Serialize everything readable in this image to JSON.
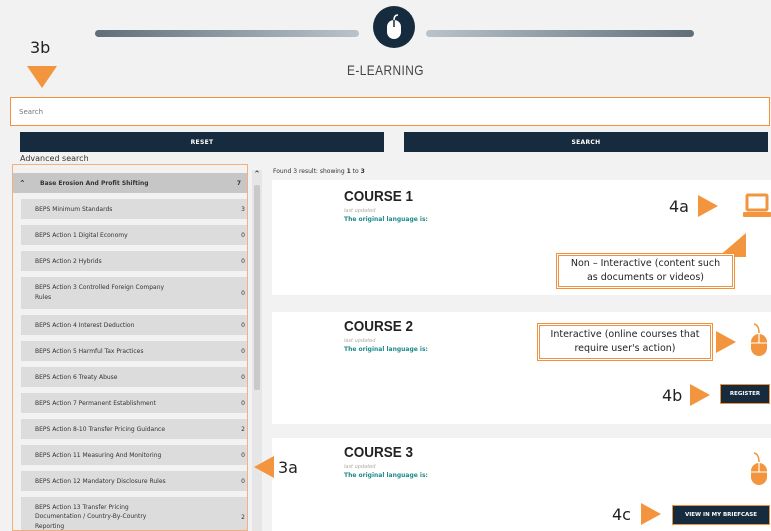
{
  "header": {
    "title": "E-LEARNING"
  },
  "search": {
    "placeholder": "Search"
  },
  "buttons": {
    "reset": "RESET",
    "search": "SEARCH",
    "register": "REGISTER",
    "briefcase": "VIEW IN MY BRIEFCASE"
  },
  "advanced_search": "Advanced search",
  "sidebar": {
    "top": {
      "label": "Base Erosion And Profit Shifting",
      "count": "7"
    },
    "items": [
      {
        "label": "BEPS Minimum Standards",
        "count": "3"
      },
      {
        "label": "BEPS Action 1 Digital Economy",
        "count": "0"
      },
      {
        "label": "BEPS Action 2 Hybrids",
        "count": "0"
      },
      {
        "label": "BEPS Action 3 Controlled Foreign Company",
        "label2": "Rules",
        "count": "0"
      },
      {
        "label": "BEPS Action 4 Interest Deduction",
        "count": "0"
      },
      {
        "label": "BEPS Action 5 Harmful Tax Practices",
        "count": "0"
      },
      {
        "label": "BEPS Action 6 Treaty Abuse",
        "count": "0"
      },
      {
        "label": "BEPS Action 7 Permanent Establishment",
        "count": "0"
      },
      {
        "label": "BEPS Action 8-10 Transfer Pricing Guidance",
        "count": "2"
      },
      {
        "label": "BEPS Action 11 Measuring And Monitoring",
        "count": "0"
      },
      {
        "label": "BEPS Action 12 Mandatory Disclosure Rules",
        "count": "0"
      },
      {
        "label": "BEPS Action 13 Transfer Pricing",
        "label2": "Documentation / Country-By-Country",
        "label3": "Reporting",
        "count": "2"
      }
    ]
  },
  "results": {
    "found_prefix": "Found 3 result: showing ",
    "from": "1",
    "to_word": " to ",
    "to": "3",
    "courses": [
      {
        "title": "COURSE 1",
        "last_updated": "last updated",
        "language": "The original language is:"
      },
      {
        "title": "COURSE 2",
        "last_updated": "last updated",
        "language": "The original language is:"
      },
      {
        "title": "COURSE 3",
        "last_updated": "last updated",
        "language": "The original language is:"
      }
    ]
  },
  "annotations": {
    "a3b": "3b",
    "a3a": "3a",
    "a4a": "4a",
    "a4b": "4b",
    "a4c": "4c",
    "non_interactive_1": "Non – Interactive (content such",
    "non_interactive_2": "as documents or videos)",
    "interactive_1": "Interactive (online courses that",
    "interactive_2": "require user's action)"
  },
  "colors": {
    "navy": "#172b3e",
    "orange": "#f2953e",
    "teal": "#1c8a8a"
  }
}
